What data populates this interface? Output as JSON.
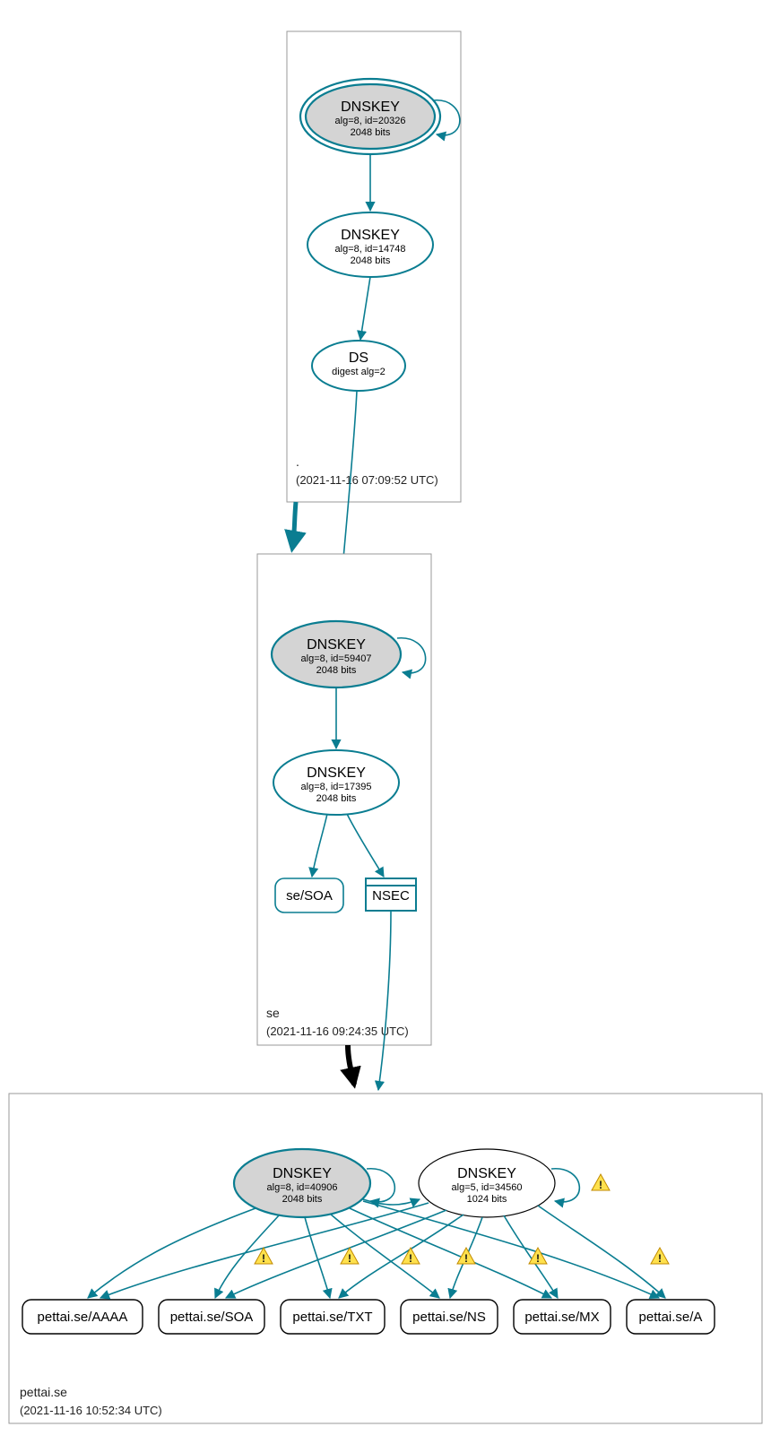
{
  "zones": {
    "root": {
      "name": ".",
      "timestamp": "(2021-11-16 07:09:52 UTC)"
    },
    "se": {
      "name": "se",
      "timestamp": "(2021-11-16 09:24:35 UTC)"
    },
    "leaf": {
      "name": "pettai.se",
      "timestamp": "(2021-11-16 10:52:34 UTC)"
    }
  },
  "nodes": {
    "root_ksk": {
      "title": "DNSKEY",
      "sub1": "alg=8, id=20326",
      "sub2": "2048 bits"
    },
    "root_zsk": {
      "title": "DNSKEY",
      "sub1": "alg=8, id=14748",
      "sub2": "2048 bits"
    },
    "root_ds": {
      "title": "DS",
      "sub1": "digest alg=2"
    },
    "se_ksk": {
      "title": "DNSKEY",
      "sub1": "alg=8, id=59407",
      "sub2": "2048 bits"
    },
    "se_zsk": {
      "title": "DNSKEY",
      "sub1": "alg=8, id=17395",
      "sub2": "2048 bits"
    },
    "se_soa": {
      "label": "se/SOA"
    },
    "se_nsec": {
      "label": "NSEC"
    },
    "leaf_ksk": {
      "title": "DNSKEY",
      "sub1": "alg=8, id=40906",
      "sub2": "2048 bits"
    },
    "leaf_zsk": {
      "title": "DNSKEY",
      "sub1": "alg=5, id=34560",
      "sub2": "1024 bits"
    },
    "rr_aaaa": {
      "label": "pettai.se/AAAA"
    },
    "rr_soa": {
      "label": "pettai.se/SOA"
    },
    "rr_txt": {
      "label": "pettai.se/TXT"
    },
    "rr_ns": {
      "label": "pettai.se/NS"
    },
    "rr_mx": {
      "label": "pettai.se/MX"
    },
    "rr_a": {
      "label": "pettai.se/A"
    }
  },
  "colors": {
    "teal": "#0a7d91"
  }
}
